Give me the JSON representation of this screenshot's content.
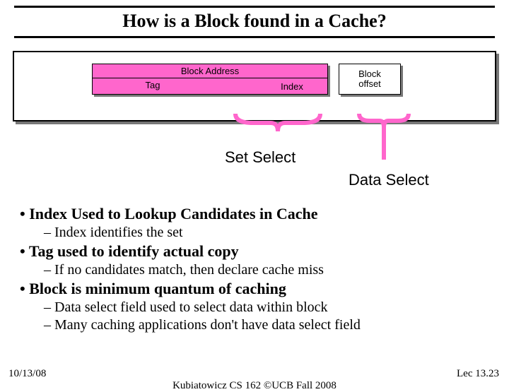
{
  "title": "How is a Block found in a Cache?",
  "diagram": {
    "block_address": "Block Address",
    "tag": "Tag",
    "index": "Index",
    "offset_l1": "Block",
    "offset_l2": "offset"
  },
  "labels": {
    "set_select": "Set Select",
    "data_select": "Data Select"
  },
  "bullets": {
    "b1": "Index Used to Lookup Candidates in Cache",
    "b1a": "Index identifies the set",
    "b2": "Tag used to identify actual copy",
    "b2a": "If no candidates match, then declare cache miss",
    "b3": "Block is minimum quantum of caching",
    "b3a": "Data select field used to select data within block",
    "b3b": "Many caching applications don't have data select field"
  },
  "footer": {
    "date": "10/13/08",
    "center": "Kubiatowicz CS 162 ©UCB Fall 2008",
    "right": "Lec 13.23"
  }
}
